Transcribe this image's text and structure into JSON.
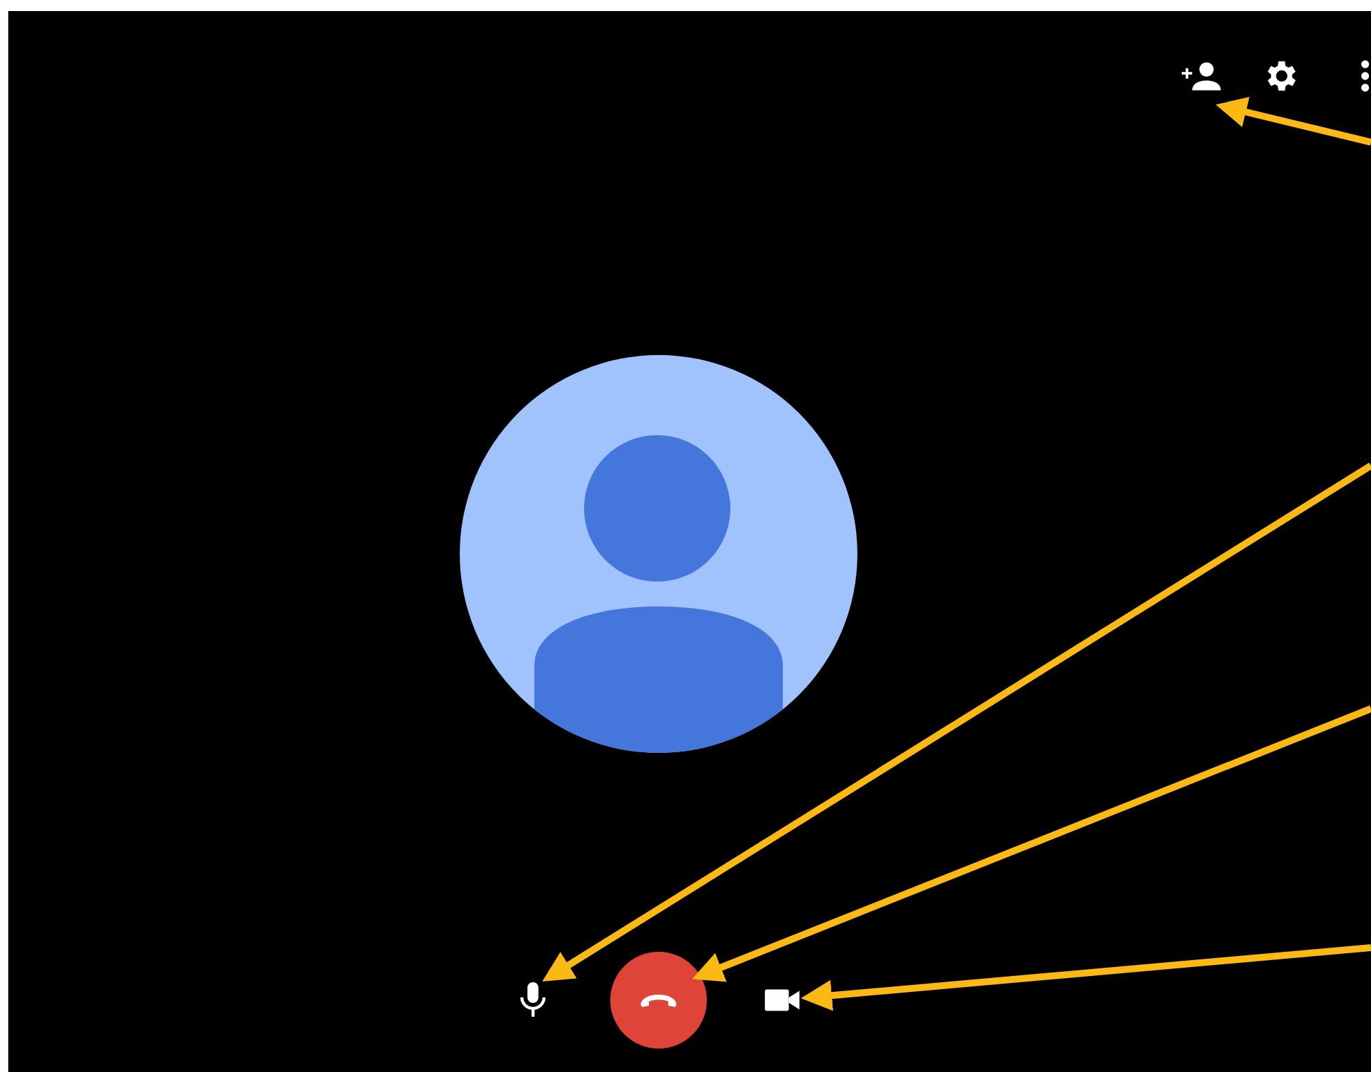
{
  "top_actions": [
    {
      "kind": "add-person"
    },
    {
      "kind": "settings"
    },
    {
      "kind": "more"
    }
  ],
  "call_controls": [
    {
      "kind": "mic"
    },
    {
      "kind": "hangup"
    },
    {
      "kind": "camera"
    }
  ]
}
